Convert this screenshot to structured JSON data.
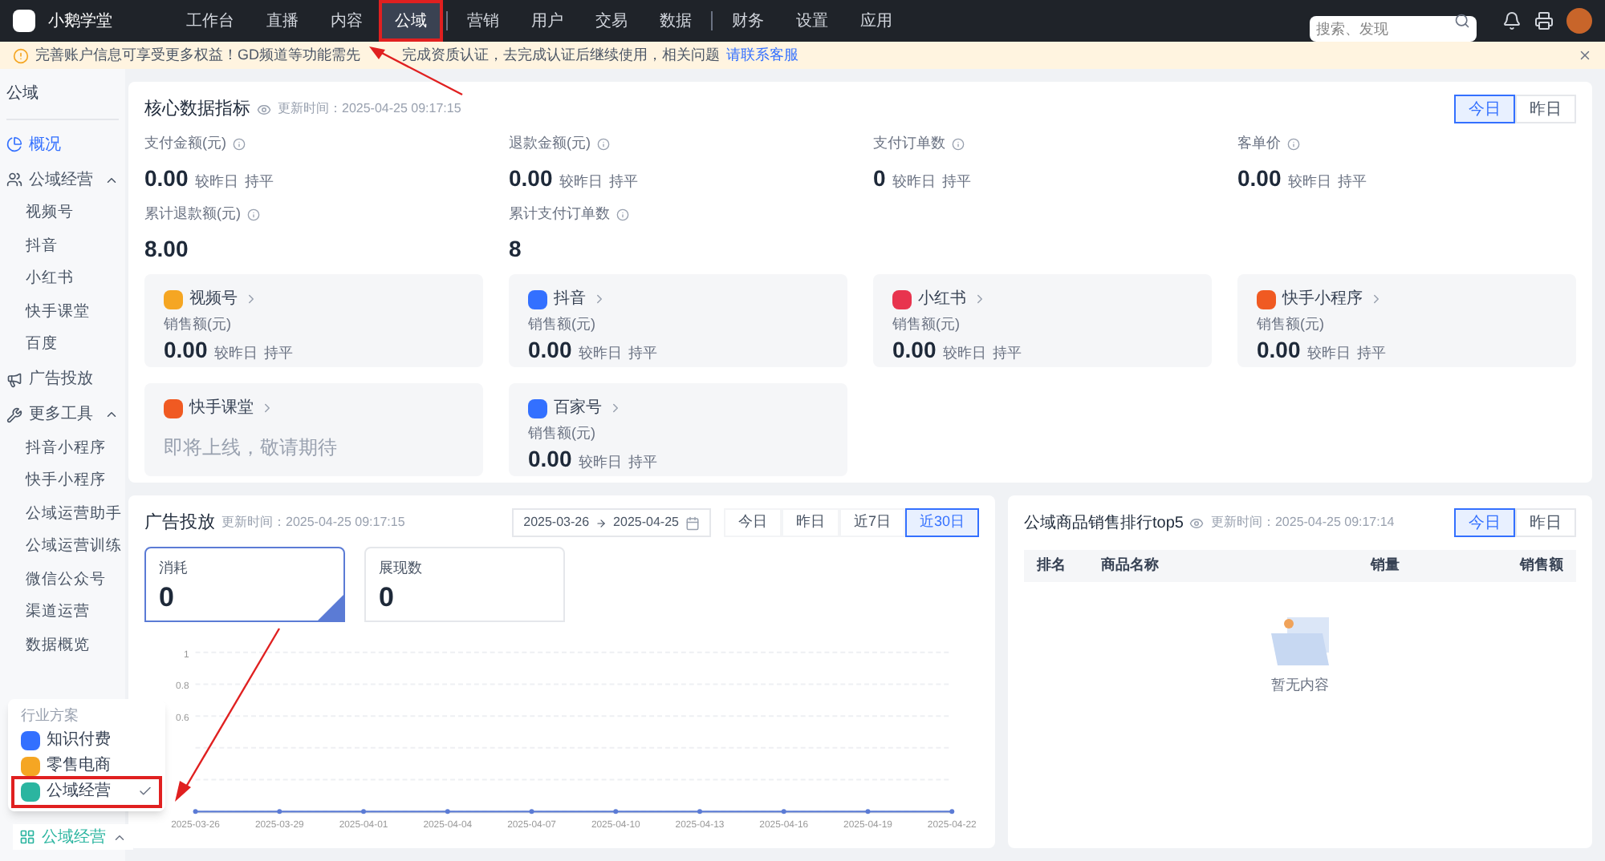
{
  "brand": "小鹅学堂",
  "nav": [
    {
      "label": "工作台",
      "selected": false,
      "divider": false
    },
    {
      "label": "直播",
      "selected": false,
      "divider": false
    },
    {
      "label": "内容",
      "selected": false,
      "divider": false
    },
    {
      "label": "公域",
      "selected": true,
      "divider": true
    },
    {
      "label": "营销",
      "selected": false,
      "divider": false
    },
    {
      "label": "用户",
      "selected": false,
      "divider": false
    },
    {
      "label": "交易",
      "selected": false,
      "divider": false
    },
    {
      "label": "数据",
      "selected": false,
      "divider": true
    },
    {
      "label": "财务",
      "selected": false,
      "divider": false
    },
    {
      "label": "设置",
      "selected": false,
      "divider": false
    },
    {
      "label": "应用",
      "selected": false,
      "divider": false
    }
  ],
  "search": {
    "placeholder": "搜索、发现"
  },
  "notice": {
    "segments": [
      "完善账户信息可享受更多权益！GD频道等功能需先",
      "完成资质认证，去完成认证后继续使用，相关问题"
    ],
    "link": "请联系客服"
  },
  "sidebar": {
    "title": "公域",
    "items": [
      {
        "label": "概况",
        "selected": true,
        "expanded": false
      },
      {
        "label": "公域经营",
        "selected": false,
        "expanded": true,
        "children": [
          {
            "label": "视频号"
          },
          {
            "label": "抖音"
          },
          {
            "label": "小红书"
          },
          {
            "label": "快手课堂"
          },
          {
            "label": "百度"
          }
        ]
      },
      {
        "label": "广告投放",
        "selected": false,
        "expanded": false
      },
      {
        "label": "更多工具",
        "selected": false,
        "expanded": true,
        "children": [
          {
            "label": "抖音小程序"
          },
          {
            "label": "快手小程序"
          },
          {
            "label": "公域运营助手"
          },
          {
            "label": "公域运营训练"
          },
          {
            "label": "微信公众号"
          },
          {
            "label": "渠道运营"
          },
          {
            "label": "数据概览"
          }
        ]
      }
    ]
  },
  "industry_menu": {
    "title": "行业方案",
    "items": [
      {
        "label": "知识付费",
        "selected": false,
        "color": "#3370ff"
      },
      {
        "label": "零售电商",
        "selected": false,
        "color": "#f5a623"
      },
      {
        "label": "公域经营",
        "selected": true,
        "color": "#2bb5a0"
      }
    ],
    "current": "公域经营"
  },
  "core": {
    "title": "核心数据指标",
    "updated": "更新时间：2025-04-25 09:17:15",
    "toggle": [
      {
        "label": "今日",
        "selected": true
      },
      {
        "label": "昨日",
        "selected": false
      }
    ],
    "metrics": [
      {
        "label": "支付金额(元)",
        "value": "0.00",
        "compare": "较昨日",
        "trend": "持平"
      },
      {
        "label": "退款金额(元)",
        "value": "0.00",
        "compare": "较昨日",
        "trend": "持平"
      },
      {
        "label": "支付订单数",
        "value": "0",
        "compare": "较昨日",
        "trend": "持平"
      },
      {
        "label": "客单价",
        "value": "0.00",
        "compare": "较昨日",
        "trend": "持平"
      },
      {
        "label": "累计退款额(元)",
        "value": "8.00"
      },
      {
        "label": "累计支付订单数",
        "value": "8"
      }
    ],
    "platforms": [
      {
        "name": "视频号",
        "color": "#f5a623",
        "kind": "stats",
        "label": "销售额(元)",
        "value": "0.00",
        "compare": "较昨日",
        "trend": "持平"
      },
      {
        "name": "抖音",
        "color": "#3370ff",
        "kind": "stats",
        "label": "销售额(元)",
        "value": "0.00",
        "compare": "较昨日",
        "trend": "持平"
      },
      {
        "name": "小红书",
        "color": "#e8344e",
        "kind": "stats",
        "label": "销售额(元)",
        "value": "0.00",
        "compare": "较昨日",
        "trend": "持平"
      },
      {
        "name": "快手小程序",
        "color": "#f05a22",
        "kind": "stats",
        "label": "销售额(元)",
        "value": "0.00",
        "compare": "较昨日",
        "trend": "持平"
      },
      {
        "name": "快手课堂",
        "color": "#f05a22",
        "kind": "soon",
        "message": "即将上线，敬请期待"
      },
      {
        "name": "百家号",
        "color": "#3370ff",
        "kind": "stats",
        "label": "销售额(元)",
        "value": "0.00",
        "compare": "较昨日",
        "trend": "持平"
      }
    ]
  },
  "ads": {
    "title": "广告投放",
    "updated": "更新时间：2025-04-25 09:17:15",
    "date_from": "2025-03-26",
    "date_to": "2025-04-25",
    "ranges": [
      {
        "label": "今日",
        "selected": false
      },
      {
        "label": "昨日",
        "selected": false
      },
      {
        "label": "近7日",
        "selected": false
      },
      {
        "label": "近30日",
        "selected": true
      }
    ],
    "kpis": [
      {
        "label": "消耗",
        "value": "0",
        "selected": true
      },
      {
        "label": "展现数",
        "value": "0",
        "selected": false
      }
    ],
    "chart_data": {
      "type": "line",
      "categories": [
        "2025-03-26",
        "2025-03-29",
        "2025-04-01",
        "2025-04-04",
        "2025-04-07",
        "2025-04-10",
        "2025-04-13",
        "2025-04-16",
        "2025-04-19",
        "2025-04-22"
      ],
      "series": [
        {
          "color": "#5b7bd5",
          "marker": true,
          "values": [
            0,
            0,
            0,
            0,
            0,
            0,
            0,
            0,
            0,
            0
          ]
        }
      ],
      "ylim": [
        0,
        1
      ],
      "yticks": [
        0.6,
        0.8,
        1
      ]
    }
  },
  "ranking": {
    "title": "公域商品销售排行top5",
    "updated": "更新时间：2025-04-25 09:17:14",
    "toggle": [
      {
        "label": "今日",
        "selected": true
      },
      {
        "label": "昨日",
        "selected": false
      }
    ],
    "columns": [
      "排名",
      "商品名称",
      "销量",
      "销售额"
    ],
    "empty": "暂无内容"
  }
}
